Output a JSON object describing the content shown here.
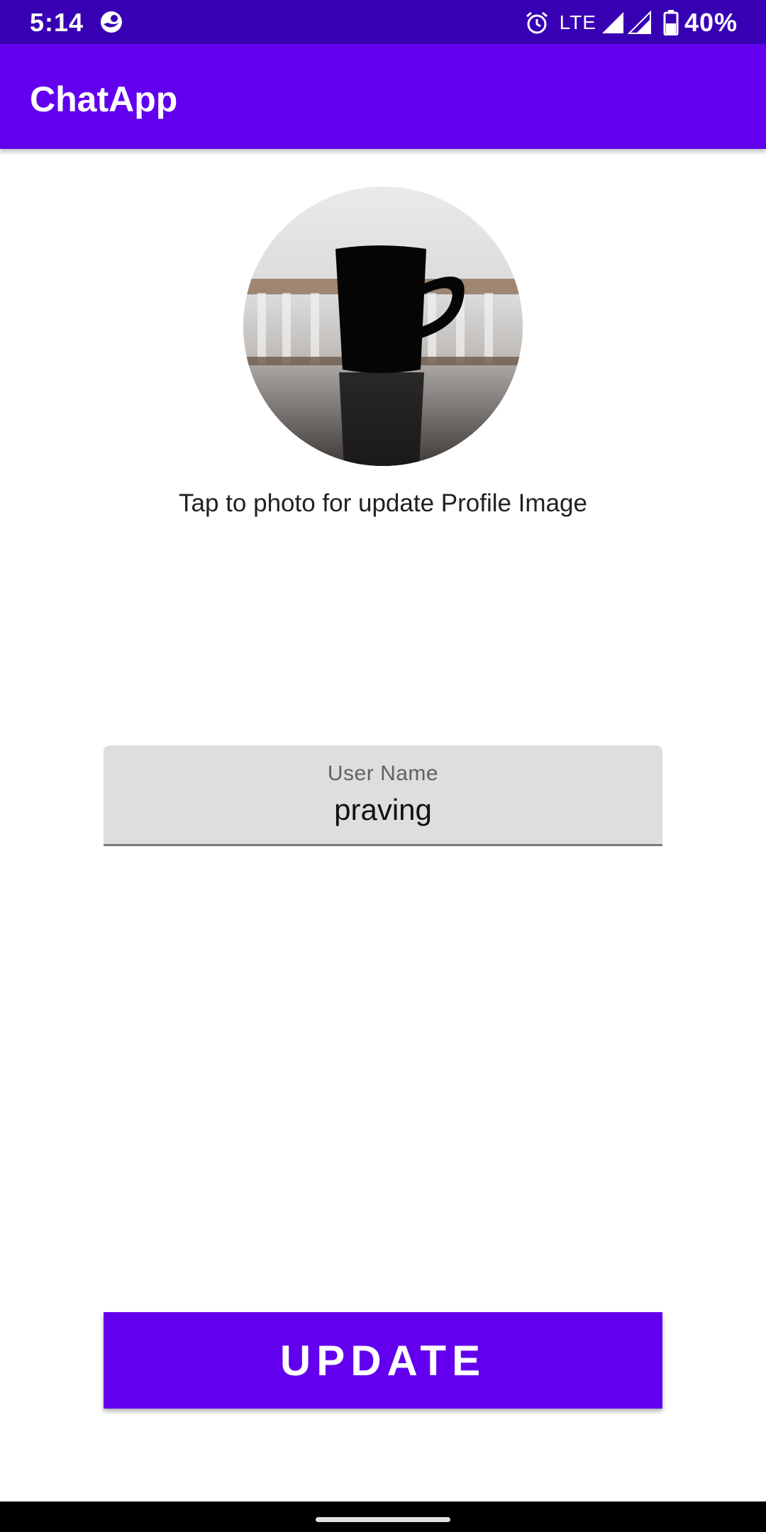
{
  "status_bar": {
    "time": "5:14",
    "network": "LTE",
    "battery": "40%",
    "icons": [
      "app-notification-icon",
      "alarm-icon",
      "signal-icon",
      "signal-icon",
      "battery-icon"
    ]
  },
  "app_bar": {
    "title": "ChatApp"
  },
  "profile": {
    "image": "coffee-mug-photo",
    "hint": "Tap to photo for update Profile Image"
  },
  "name_field": {
    "label": "User Name",
    "value": "praving"
  },
  "update_button": {
    "label": "UPDATE"
  },
  "colors": {
    "primary": "#6200ee",
    "primary_dark": "#3700b3",
    "field_background": "#dedede"
  }
}
